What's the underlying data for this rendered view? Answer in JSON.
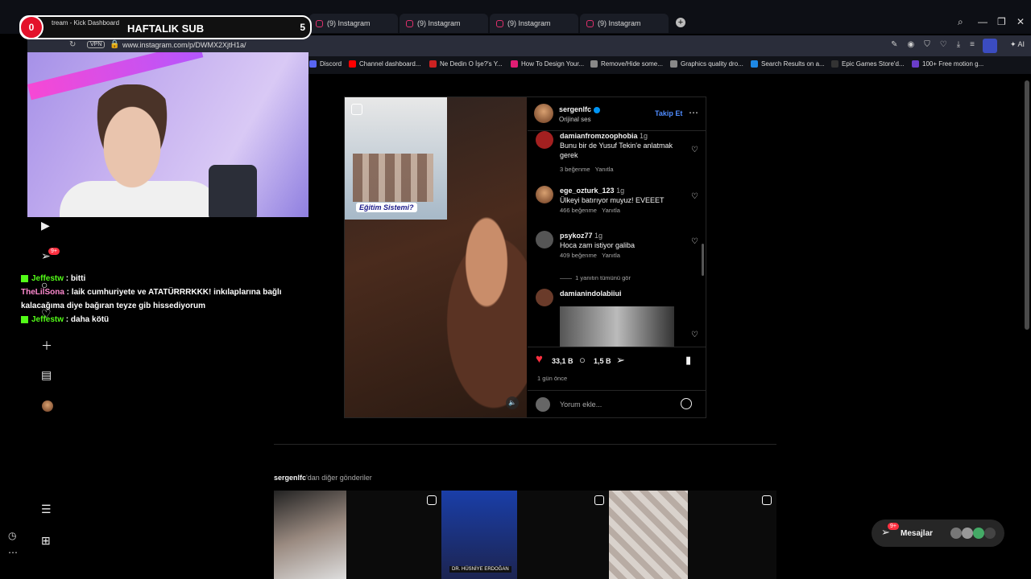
{
  "browser": {
    "tabs": [
      {
        "label": "(9) Instagram"
      },
      {
        "label": "(9) Instagram"
      },
      {
        "label": "(9) Instagram"
      },
      {
        "label": "(9) Instagram"
      }
    ],
    "overlay_tab_left": "tream - Kick Dashboard",
    "overlay_tab_mid": "(9) Instagram",
    "url": "www.instagram.com/p/DWMX2XjtH1a/",
    "vpn": "VPN",
    "ai_label": "AI",
    "bookmarks": [
      {
        "label": "Discord",
        "color": "#5865f2"
      },
      {
        "label": "Channel dashboard...",
        "color": "#ff0000"
      },
      {
        "label": "Ne Dedin O İşe?'s Y...",
        "color": "#cc2222"
      },
      {
        "label": "How To Design Your...",
        "color": "#e11d74"
      },
      {
        "label": "Remove/Hide some...",
        "color": "#888888"
      },
      {
        "label": "Graphics quality dro...",
        "color": "#888888"
      },
      {
        "label": "Search Results on a...",
        "color": "#1e88e5"
      },
      {
        "label": "Epic Games Store'd...",
        "color": "#333333"
      },
      {
        "label": "100+ Free motion g...",
        "color": "#6a3dc9"
      }
    ]
  },
  "stream_overlay": {
    "counter": "0",
    "title": "HAFTALIK SUB",
    "right_value": "5"
  },
  "chat": [
    {
      "user": "Jeffestw",
      "sep": " : ",
      "text": "bitti"
    },
    {
      "user": "TheLilSona",
      "sep": " : ",
      "text": "laik cumhuriyete ve ATATÜRRRKKK! inkılaplarına bağlı kalacağıma diye bağıran teyze gib hissediyorum"
    },
    {
      "user": "Jeffestw",
      "sep": " : ",
      "text": "daha kötü"
    }
  ],
  "leftnav": {
    "notifications_badge": "9+"
  },
  "post": {
    "author": "sergenlfc",
    "audio": "Orijinal ses",
    "follow_label": "Takip Et",
    "more": "•••",
    "media_caption": "Eğitim Sistemi?",
    "comments": [
      {
        "user": "damianfromzoophobia",
        "time": "1g",
        "text": "Bunu bir de Yusuf Tekin'e anlatmak gerek",
        "likes": "3 beğenme",
        "reply": "Yanıtla"
      },
      {
        "user": "ege_ozturk_123",
        "time": "1g",
        "text": "Ülkeyi batırıyor muyuz! EVEEET",
        "likes": "466 beğenme",
        "reply": "Yanıtla"
      },
      {
        "user": "psykoz77",
        "time": "1g",
        "text": "Hoca zam istiyor galiba",
        "likes": "409 beğenme",
        "reply": "Yanıtla"
      }
    ],
    "view_replies": "1 yanıtın tümünü gör",
    "last_comment_user": "damianindolabiiui",
    "like_count": "33,1 B",
    "comment_count": "1,5 B",
    "time_ago": "1 gün önce",
    "comment_placeholder": "Yorum ekle..."
  },
  "more_posts": {
    "user": "sergenlfc",
    "suffix": "'dan diğer gönderiler",
    "thumb_caption": "DR. HÜSNİYE ERDOĞAN"
  },
  "messages": {
    "label": "Mesajlar",
    "badge": "9+"
  },
  "colors": {
    "accent_red": "#ff3040",
    "link_blue": "#4f8cff",
    "kick_green": "#53fc18"
  }
}
